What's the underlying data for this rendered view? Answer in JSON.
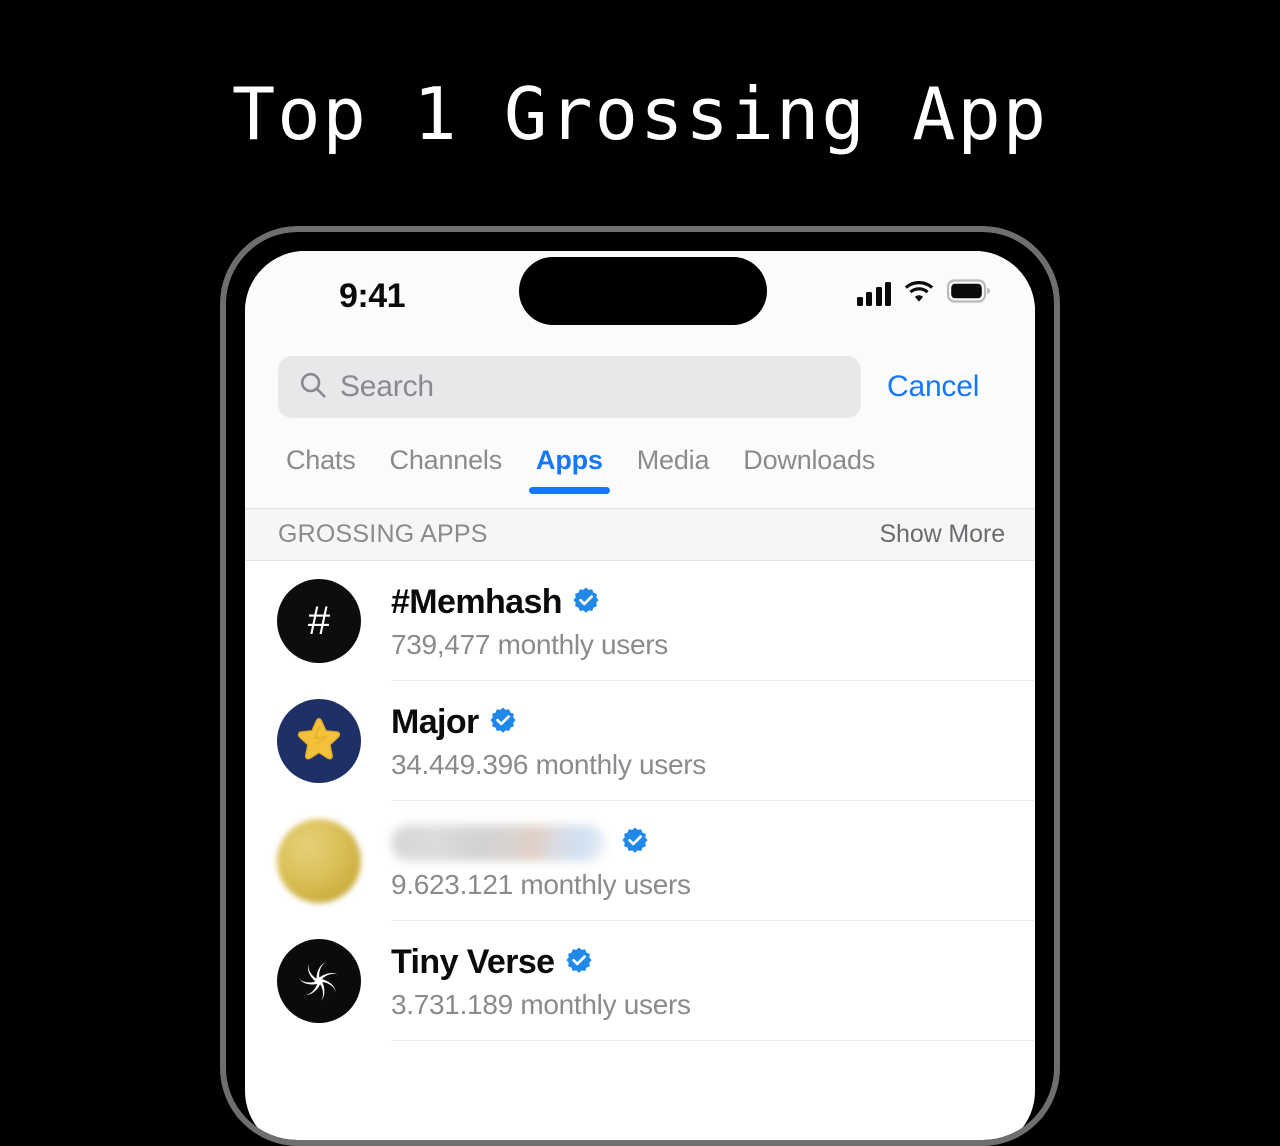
{
  "headline": "Top 1 Grossing App",
  "colors": {
    "accent_blue": "#1478ff",
    "verified_blue": "#2088e8",
    "background": "#000000",
    "screen_bg": "#ffffff",
    "bezel": "#6f6f6f"
  },
  "status_bar": {
    "time": "9:41",
    "icons": [
      "cellular-signal-icon",
      "wifi-icon",
      "battery-icon"
    ]
  },
  "search": {
    "placeholder": "Search",
    "value": "",
    "icon": "search-icon",
    "cancel_label": "Cancel"
  },
  "tabs": [
    {
      "label": "Chats",
      "active": false
    },
    {
      "label": "Channels",
      "active": false
    },
    {
      "label": "Apps",
      "active": true
    },
    {
      "label": "Media",
      "active": false
    },
    {
      "label": "Downloads",
      "active": false
    }
  ],
  "section": {
    "title": "GROSSING APPS",
    "show_more_label": "Show More"
  },
  "apps": [
    {
      "name": "#Memhash",
      "name_hidden": false,
      "verified": true,
      "subtitle": "739,477 monthly users",
      "avatar": "hash-avatar",
      "avatar_glyph": "#"
    },
    {
      "name": "Major",
      "name_hidden": false,
      "verified": true,
      "subtitle": "34.449.396 monthly users",
      "avatar": "star-avatar",
      "avatar_glyph": ""
    },
    {
      "name": "",
      "name_hidden": true,
      "verified": true,
      "subtitle": "9.623.121 monthly users",
      "avatar": "blurred-gold-avatar",
      "avatar_glyph": ""
    },
    {
      "name": "Tiny Verse",
      "name_hidden": false,
      "verified": true,
      "subtitle": "3.731.189 monthly users",
      "avatar": "pinwheel-avatar",
      "avatar_glyph": ""
    }
  ]
}
